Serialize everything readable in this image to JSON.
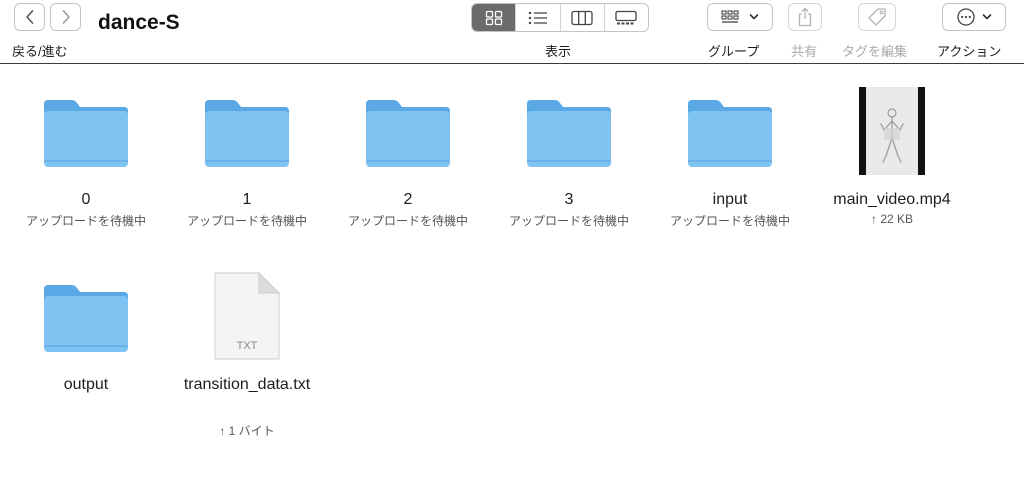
{
  "window": {
    "title": "dance-S",
    "nav_label": "戻る/進む"
  },
  "toolbar": {
    "view_label": "表示",
    "group_label": "グループ",
    "share_label": "共有",
    "tag_label": "タグを編集",
    "action_label": "アクション",
    "active_view": "icon-view"
  },
  "items": [
    {
      "name": "0",
      "kind": "folder",
      "status": "アップロードを待機中"
    },
    {
      "name": "1",
      "kind": "folder",
      "status": "アップロードを待機中"
    },
    {
      "name": "2",
      "kind": "folder",
      "status": "アップロードを待機中"
    },
    {
      "name": "3",
      "kind": "folder",
      "status": "アップロードを待機中"
    },
    {
      "name": "input",
      "kind": "folder",
      "status": "アップロードを待機中"
    },
    {
      "name": "main_video.mp4",
      "kind": "video",
      "status": "↑ 22 KB"
    },
    {
      "name": "output",
      "kind": "folder",
      "status": ""
    },
    {
      "name": "transition_data.txt",
      "kind": "text",
      "status": "↑ 1 バイト",
      "badge": "TXT"
    }
  ],
  "colors": {
    "folder_body": "#7fc3f3",
    "folder_tab": "#5aa9e6",
    "active_segment": "#6b6b6b"
  }
}
